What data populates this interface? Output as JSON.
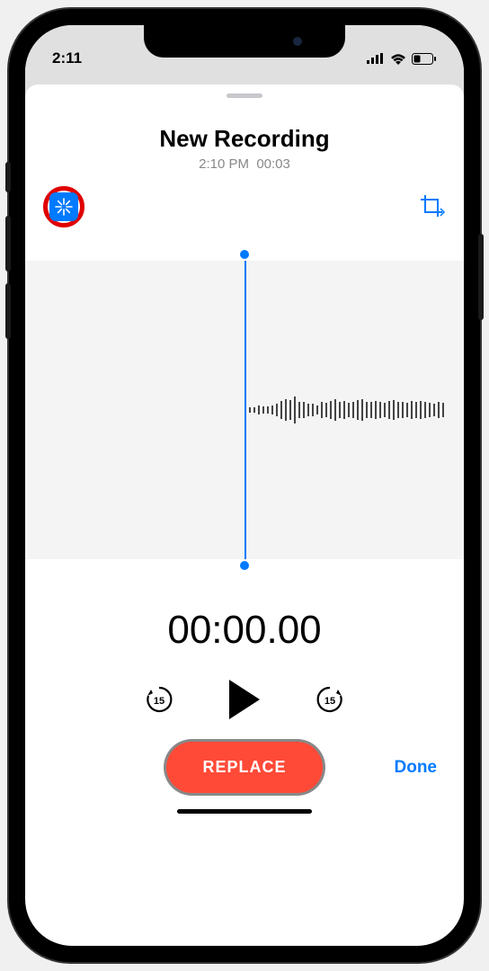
{
  "status": {
    "time": "2:11"
  },
  "header": {
    "title": "New Recording",
    "timestamp": "2:10 PM",
    "duration": "00:03"
  },
  "icons": {
    "wand": "magic-wand-icon",
    "crop": "crop-icon",
    "skipBack": "skip-back-15-icon",
    "play": "play-icon",
    "skipFwd": "skip-forward-15-icon"
  },
  "timer": "00:00.00",
  "buttons": {
    "replace": "REPLACE",
    "done": "Done"
  },
  "skip_seconds": "15",
  "colors": {
    "accent": "#007aff",
    "record": "#ff4a37",
    "highlight": "#e00000"
  }
}
